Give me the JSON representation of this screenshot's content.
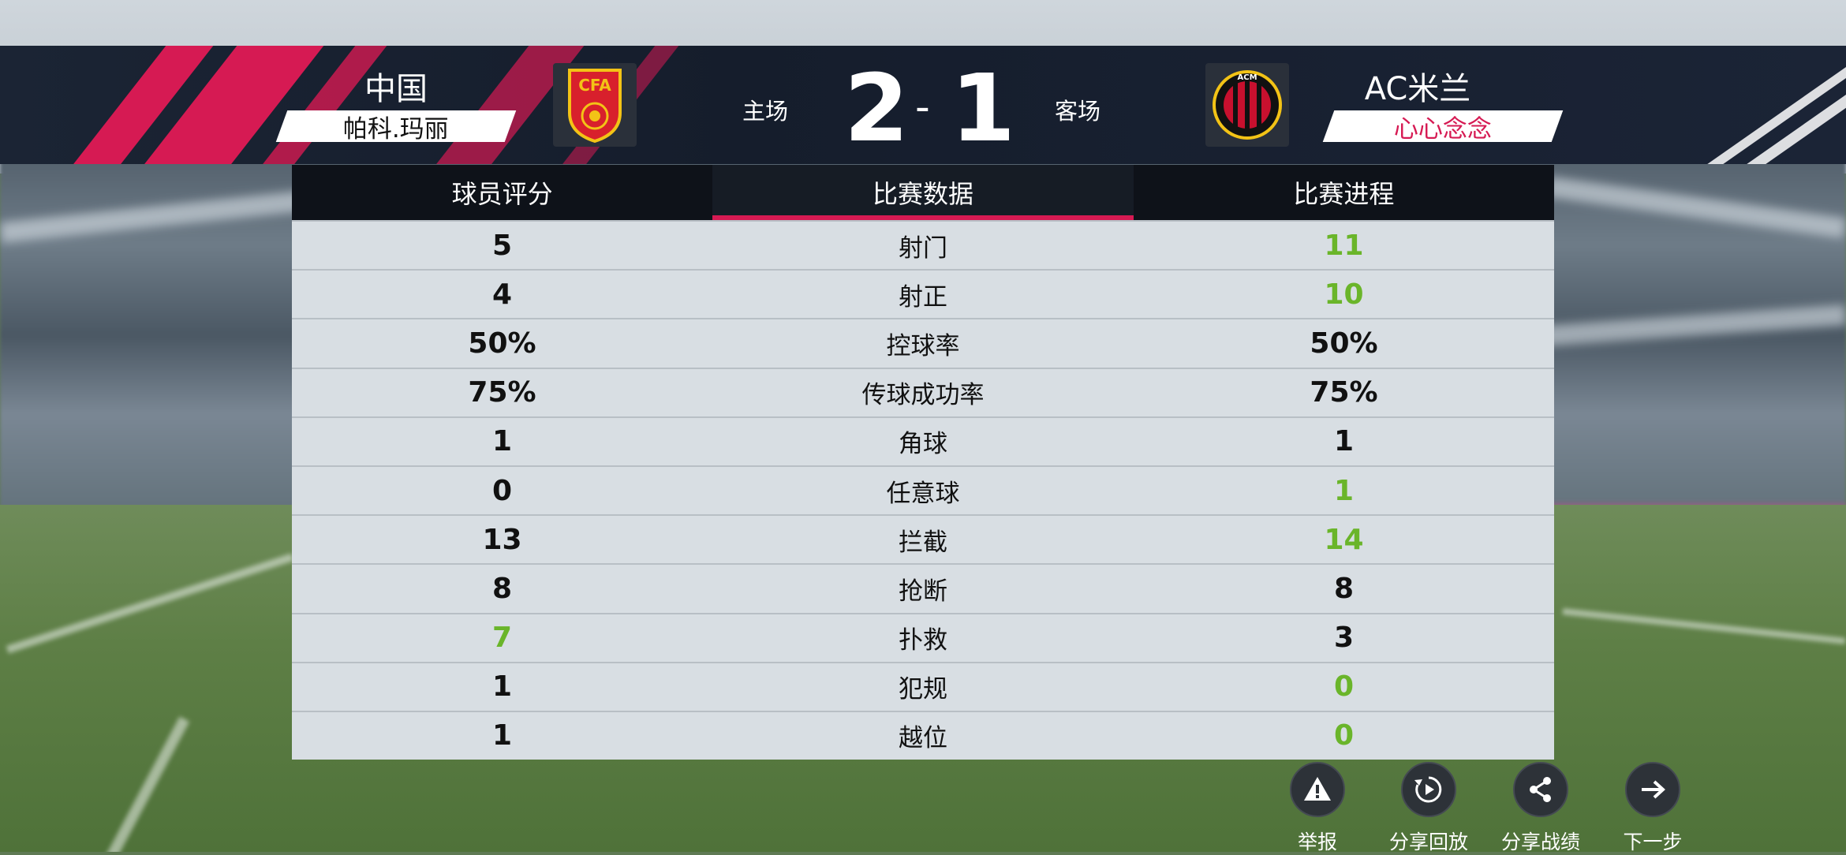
{
  "header": {
    "home": {
      "team": "中国",
      "player": "帕科.玛丽",
      "side": "主场",
      "score": "2"
    },
    "away": {
      "team": "AC米兰",
      "player": "心心念念",
      "side": "客场",
      "score": "1"
    },
    "separator": "-"
  },
  "tabs": [
    {
      "label": "球员评分",
      "active": false
    },
    {
      "label": "比赛数据",
      "active": true
    },
    {
      "label": "比赛进程",
      "active": false
    }
  ],
  "stats": [
    {
      "label": "射门",
      "home": "5",
      "away": "11",
      "highlight": "away"
    },
    {
      "label": "射正",
      "home": "4",
      "away": "10",
      "highlight": "away"
    },
    {
      "label": "控球率",
      "home": "50%",
      "away": "50%",
      "highlight": "none"
    },
    {
      "label": "传球成功率",
      "home": "75%",
      "away": "75%",
      "highlight": "none"
    },
    {
      "label": "角球",
      "home": "1",
      "away": "1",
      "highlight": "none"
    },
    {
      "label": "任意球",
      "home": "0",
      "away": "1",
      "highlight": "away"
    },
    {
      "label": "拦截",
      "home": "13",
      "away": "14",
      "highlight": "away"
    },
    {
      "label": "抢断",
      "home": "8",
      "away": "8",
      "highlight": "none"
    },
    {
      "label": "扑救",
      "home": "7",
      "away": "3",
      "highlight": "home"
    },
    {
      "label": "犯规",
      "home": "1",
      "away": "0",
      "highlight": "away"
    },
    {
      "label": "越位",
      "home": "1",
      "away": "0",
      "highlight": "away"
    }
  ],
  "actions": [
    {
      "label": "举报",
      "icon": "warning-icon"
    },
    {
      "label": "分享回放",
      "icon": "replay-icon"
    },
    {
      "label": "分享战绩",
      "icon": "share-icon"
    },
    {
      "label": "下一步",
      "icon": "arrow-right-icon"
    }
  ],
  "colors": {
    "accent": "#d61a53",
    "highlight": "#6ab52a",
    "away_player_tag": "#d61a53"
  }
}
